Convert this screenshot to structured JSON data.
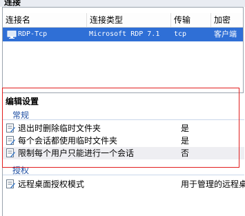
{
  "panel_header": "连接",
  "table": {
    "columns": [
      "连接名",
      "连接类型",
      "传输",
      "加密"
    ],
    "rows": [
      {
        "name": "RDP-Tcp",
        "type": "Microsoft RDP 7.1",
        "transport": "tcp",
        "encryption": "客户端兼"
      }
    ]
  },
  "edit_settings": {
    "title": "编辑设置",
    "groups": [
      {
        "title": "常规",
        "items": [
          {
            "label": "退出时删除临时文件夹",
            "value": "是"
          },
          {
            "label": "每个会话都使用临时文件夹",
            "value": "是"
          },
          {
            "label": "限制每个用户只能进行一个会话",
            "value": "否"
          }
        ]
      },
      {
        "title": "授权",
        "items": [
          {
            "label": "远程桌面授权模式",
            "value": "用于管理的远程桌"
          }
        ]
      }
    ]
  },
  "colors": {
    "selection": "#2f6fd6",
    "highlight_border": "#e21d1d",
    "group_title": "#1f4fa3"
  }
}
